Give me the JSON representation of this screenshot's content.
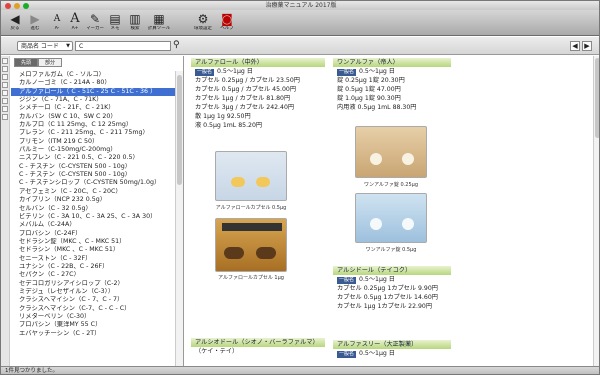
{
  "window": {
    "title": "治療薬マニュアル 2017版"
  },
  "toolbar": {
    "buttons": [
      {
        "label": "戻る",
        "icon": "back-arrow"
      },
      {
        "label": "進む",
        "icon": "forward-arrow"
      },
      {
        "label": "A-",
        "icon": "font-smaller"
      },
      {
        "label": "A+",
        "icon": "font-larger"
      },
      {
        "label": "マーカー",
        "icon": "marker"
      },
      {
        "label": "メモ",
        "icon": "memo"
      },
      {
        "label": "検索",
        "icon": "find-book"
      },
      {
        "label": "計算ツール",
        "icon": "calculator"
      },
      {
        "label": "環境設定",
        "icon": "gear"
      },
      {
        "label": "ヘルプ",
        "icon": "help"
      }
    ]
  },
  "search": {
    "mode": "商品名 コード",
    "query": "C"
  },
  "segments": [
    "先頭",
    "部分"
  ],
  "list": [
    "メロファルガム（C - ソルコ）",
    "カルノーゴミ（C - 214A - 80）",
    "アルファロール（ C - 51C - 25 C - 51C - 36 ）",
    "ジジン（C - 71A、C - 71K）",
    "シメチーロ（C - 21F、C - 21K）",
    "カルバン（SW C 10、SW C 20）",
    "カルブロ（C 11 25mg、C 12 25mg）",
    "プレラン（C - 211 25mg、C - 211 75mg）",
    "プリモン（ITM 219 C 50）",
    "パルミー（C-150mg/C-200mg）",
    "ニスプレン（C - 221 0.5、C - 220 0.5）",
    "C - チスチン（C-CYSTEN 500 - 10g）",
    "C - チステン（C-CYSTEN 500 - 10g）",
    "C - チステンシロップ（C-CYSTEN 50mg/1.0g）",
    "アセフェミン（C - 20C、C - 20C）",
    "カイプリン（NCP 232 0.5g）",
    "セルバン（C - 32 0.5g）",
    "ビテリン（C - 3A 10、C - 3A 25、C - 3A 30）",
    "メバルム（C-24A）",
    "プロバシン（C-24F）",
    "セドラシン錠（MKC 、C - MKC 51）",
    "セドラシン（MKC 、C - MKC 51）",
    "セニーストン（C - 32F）",
    "ユナシン（C - 22B、C - 26F）",
    "セパクン（C - 27C）",
    "セデコロガリシアイシロップ（C-2）",
    "ミデジュ（レセザイルン（C-3））",
    "クラシスヘマイシン（C - 7、C - 7）",
    "クラシスヘマイシン（C-7、C - C - C）",
    "リメターベリン（C-30）",
    "プロパシン（東洋MY 55 C）",
    "エバヤッチーシン（C - 2T）"
  ],
  "selected_index": 2,
  "sections": {
    "s1": {
      "title": "アルファロール（中外）",
      "rows": [
        {
          "tag": "一般名",
          "text": "0.5～1μg 日"
        },
        {
          "tag": "",
          "text": "カプセル 0.25μg / カプセル 23.50円"
        },
        {
          "tag": "",
          "text": "カプセル 0.5μg / カプセル 45.00円"
        },
        {
          "tag": "",
          "text": "カプセル 1μg / カプセル 81.80円"
        },
        {
          "tag": "",
          "text": "カプセル 3μg / カプセル 242.40円"
        },
        {
          "tag": "",
          "text": "散 1μg 1g 92.50円"
        },
        {
          "tag": "",
          "text": "液 0.5μg 1mL 85.20円"
        }
      ],
      "captions": [
        "アルファロールカプセル 0.5μg",
        "アルファロールカプセル 1μg"
      ]
    },
    "s2": {
      "title": "ワンアルファ（帝人）",
      "rows": [
        {
          "tag": "一般名",
          "text": "0.5～1μg 日"
        },
        {
          "tag": "",
          "text": "錠 0.25μg 1錠 20.30円"
        },
        {
          "tag": "",
          "text": "錠 0.5μg 1錠 47.00円"
        },
        {
          "tag": "",
          "text": "錠 1.0μg 1錠 90.30円"
        },
        {
          "tag": "",
          "text": "内用液 0.5μg 1mL 88.30円"
        }
      ],
      "captions": [
        "ワンアルファ錠 0.25μg",
        "ワンアルファ錠 0.5μg"
      ]
    },
    "s3": {
      "title": "アルシドール（テイコク）",
      "rows": [
        {
          "tag": "一般名",
          "text": "0.5～1μg 日"
        },
        {
          "tag": "",
          "text": "カプセル 0.25μg 1カプセル 9.90円"
        },
        {
          "tag": "",
          "text": "カプセル 0.5μg 1カプセル 14.60円"
        },
        {
          "tag": "",
          "text": "カプセル 1μg 1カプセル 22.90円"
        }
      ]
    },
    "s4": {
      "title": "アルシオドール（シオノ・バーラファルマ）",
      "rows": [
        {
          "tag": "",
          "text": "（ケイ・テイ）"
        }
      ]
    },
    "s5": {
      "title": "アルファスリー（大正製薬）",
      "rows": [
        {
          "tag": "一般名",
          "text": "0.5～1μg 日"
        }
      ]
    }
  },
  "status": "1件見つかりました。"
}
